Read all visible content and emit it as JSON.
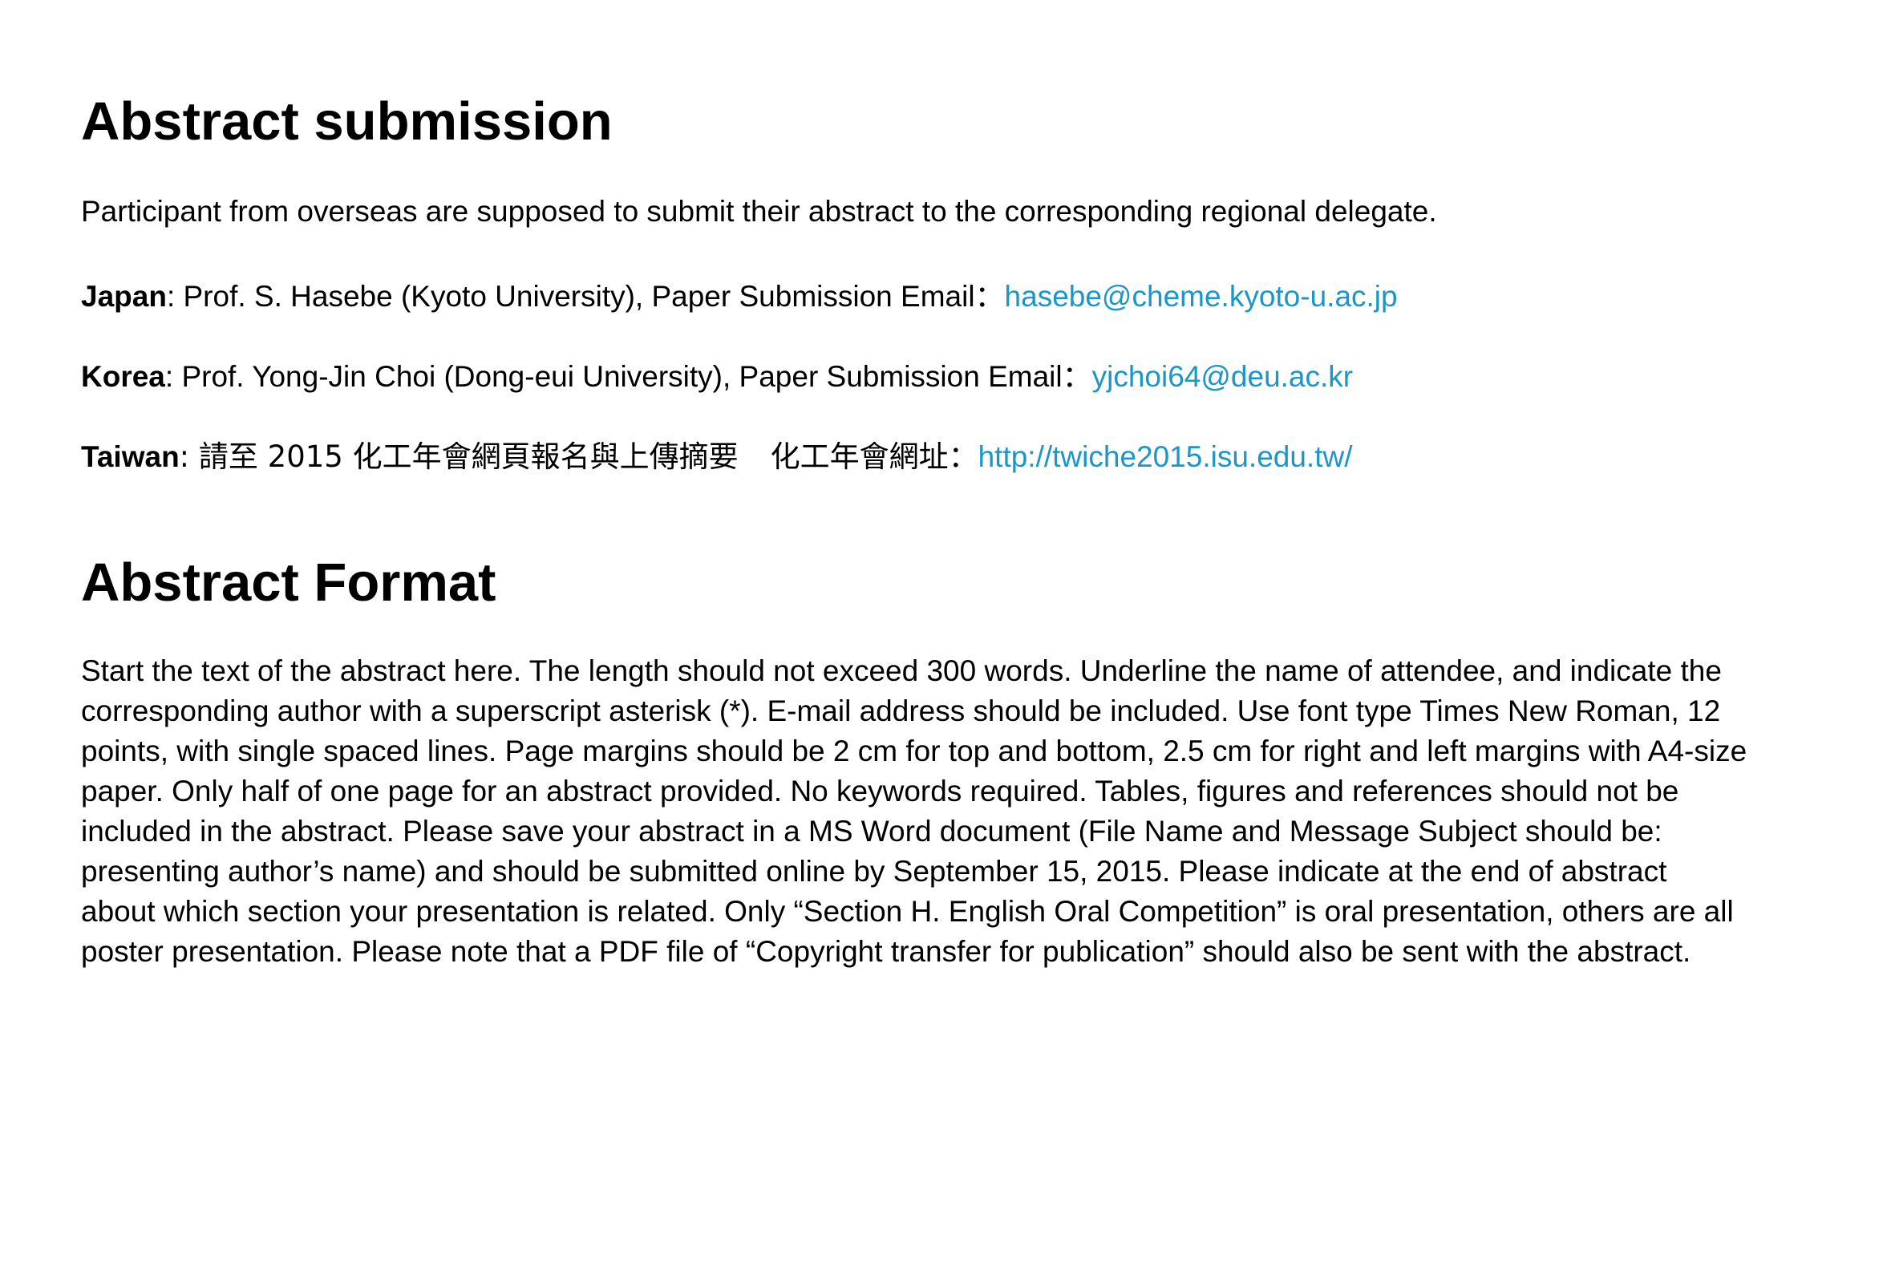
{
  "section_1": {
    "heading": "Abstract submission",
    "intro": "Participant from overseas are supposed to submit their abstract to the corresponding regional delegate.",
    "contacts": [
      {
        "region": "Japan",
        "text": ": Prof. S. Hasebe (Kyoto University), Paper Submission Email：",
        "link": "hasebe@cheme.kyoto-u.ac.jp"
      },
      {
        "region": "Korea",
        "text": ": Prof. Yong-Jin Choi (Dong-eui University), Paper Submission Email：",
        "link": "yjchoi64@deu.ac.kr"
      },
      {
        "region": "Taiwan",
        "text_1": ":  請至 2015 化工年會網頁報名與上傳摘要",
        "text_2": "化工年會網址：",
        "link": "http://twiche2015.isu.edu.tw/"
      }
    ]
  },
  "section_2": {
    "heading": "Abstract Format",
    "lines": [
      "Start the text of the abstract here. The length should not exceed 300 words. Underline the name of attendee, and indicate the",
      "corresponding author with a superscript asterisk (*). E-mail address should be included. Use font type Times New Roman, 12",
      "points, with single spaced lines. Page margins should be 2 cm for top and bottom, 2.5 cm for right and left margins with A4-size",
      "paper. Only half of one page for an abstract provided. No keywords required. Tables, figures and references should not be",
      "included in the abstract. Please save your abstract in a MS Word document (File Name and Message Subject should be:",
      "presenting author’s name) and should be submitted online by September 15, 2015. Please indicate at the end of abstract",
      "about which section your presentation is related. Only “Section H. English Oral Competition” is oral presentation, others are all",
      "poster presentation. Please note that a PDF file of “Copyright transfer for publication” should also be sent with the abstract."
    ]
  },
  "colors": {
    "text": "#000000",
    "link": "#1b96c9",
    "background": "#ffffff"
  }
}
